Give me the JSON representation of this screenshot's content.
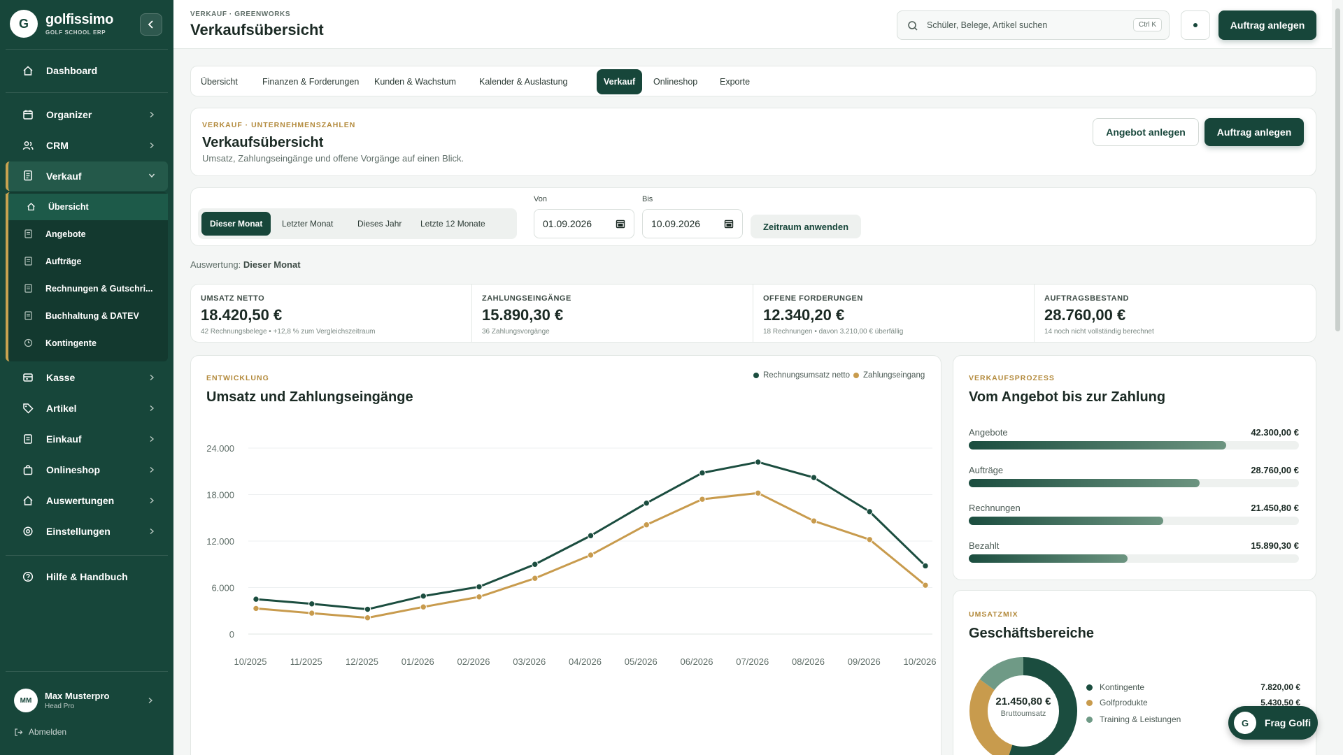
{
  "sidebar": {
    "brand": {
      "logo": "G",
      "name": "golfissimo",
      "sub": "GOLF SCHOOL ERP"
    },
    "collapse_icon": "chevron-left-icon",
    "items": [
      {
        "label": "Dashboard",
        "icon": "home-icon"
      },
      {
        "label": "Organizer",
        "icon": "calendar-icon"
      },
      {
        "label": "CRM",
        "icon": "users-icon"
      },
      {
        "label": "Verkauf",
        "icon": "document-icon"
      },
      {
        "label": "Kasse",
        "icon": "register-icon"
      },
      {
        "label": "Artikel",
        "icon": "tag-icon"
      },
      {
        "label": "Einkauf",
        "icon": "cart-icon"
      },
      {
        "label": "Onlineshop",
        "icon": "bag-icon"
      },
      {
        "label": "Auswertungen",
        "icon": "chart-icon"
      },
      {
        "label": "Einstellungen",
        "icon": "gear-icon"
      },
      {
        "label": "Hilfe & Handbuch",
        "icon": "help-icon"
      }
    ],
    "sub_items": [
      {
        "label": "Übersicht"
      },
      {
        "label": "Angebote"
      },
      {
        "label": "Aufträge"
      },
      {
        "label": "Rechnungen & Gutschri..."
      },
      {
        "label": "Buchhaltung & DATEV"
      },
      {
        "label": "Kontingente"
      }
    ],
    "user": {
      "initials": "MM",
      "name": "Max Musterpro",
      "role": "Head Pro"
    },
    "logout": "Abmelden"
  },
  "header": {
    "breadcrumb": "VERKAUF · GREENWORKS",
    "title": "Verkaufsübersicht",
    "search_placeholder": "Schüler, Belege, Artikel suchen",
    "shortcut": "Ctrl K",
    "primary_button": "Auftrag anlegen"
  },
  "tabs": [
    "Übersicht",
    "Finanzen & Forderungen",
    "Kunden & Wachstum",
    "Kalender & Auslastung",
    "Verkauf",
    "Onlineshop",
    "Exporte"
  ],
  "intro": {
    "eyebrow": "VERKAUF · UNTERNEHMENSZAHLEN",
    "title": "Verkaufsübersicht",
    "subtitle": "Umsatz, Zahlungseingänge und offene Vorgänge auf einen Blick.",
    "secondary_button": "Angebot anlegen",
    "primary_button": "Auftrag anlegen"
  },
  "filter": {
    "periods": [
      "Dieser Monat",
      "Letzter Monat",
      "Dieses Jahr",
      "Letzte 12 Monate"
    ],
    "from_label": "Von",
    "from_value": "01.09.2026",
    "to_label": "Bis",
    "to_value": "10.09.2026",
    "apply": "Zeitraum anwenden",
    "evaluation_label": "Auswertung:",
    "evaluation_value": "Dieser Monat"
  },
  "kpis": [
    {
      "label": "UMSATZ NETTO",
      "value": "18.420,50 €",
      "sub": "42 Rechnungsbelege • +12,8 % zum Vergleichszeitraum"
    },
    {
      "label": "ZAHLUNGSEINGÄNGE",
      "value": "15.890,30 €",
      "sub": "36 Zahlungsvorgänge"
    },
    {
      "label": "OFFENE FORDERUNGEN",
      "value": "12.340,20 €",
      "sub": "18 Rechnungen • davon 3.210,00 € überfällig"
    },
    {
      "label": "AUFTRAGSBESTAND",
      "value": "28.760,00 €",
      "sub": "14 noch nicht vollständig berechnet"
    }
  ],
  "trend": {
    "eyebrow": "ENTWICKLUNG",
    "title": "Umsatz und Zahlungseingänge"
  },
  "chart_data": {
    "type": "line",
    "title": "Umsatz und Zahlungseingänge",
    "x": [
      "10/2025",
      "11/2025",
      "12/2025",
      "01/2026",
      "02/2026",
      "03/2026",
      "04/2026",
      "05/2026",
      "06/2026",
      "07/2026",
      "08/2026",
      "09/2026",
      "10/2026"
    ],
    "y_ticks": [
      "0",
      "6.000",
      "12.000",
      "18.000",
      "24.000"
    ],
    "ylim": [
      0,
      24000
    ],
    "grid": true,
    "legend_position": "top-right",
    "series": [
      {
        "name": "Rechnungsumsatz netto",
        "color": "#1b4d3f",
        "values": [
          4500,
          3900,
          3200,
          4900,
          6100,
          9000,
          12700,
          16900,
          20800,
          22200,
          20200,
          15800,
          8800
        ]
      },
      {
        "name": "Zahlungseingang",
        "color": "#c89b4d",
        "values": [
          3300,
          2700,
          2100,
          3500,
          4800,
          7200,
          10200,
          14100,
          17400,
          18200,
          14600,
          12200,
          6300
        ]
      }
    ]
  },
  "funnel": {
    "eyebrow": "VERKAUFSPROZESS",
    "title": "Vom Angebot bis zur Zahlung",
    "rows": [
      {
        "label": "Angebote",
        "value": "42.300,00 €",
        "fraction": 0.78
      },
      {
        "label": "Aufträge",
        "value": "28.760,00 €",
        "fraction": 0.7
      },
      {
        "label": "Rechnungen",
        "value": "21.450,80 €",
        "fraction": 0.59
      },
      {
        "label": "Bezahlt",
        "value": "15.890,30 €",
        "fraction": 0.48
      }
    ]
  },
  "mix": {
    "eyebrow": "UMSATZMIX",
    "title": "Geschäftsbereiche",
    "center_value": "21.450,80 €",
    "center_label": "Bruttoumsatz",
    "rows": [
      {
        "label": "Kontingente",
        "value": "7.820,00 €",
        "color": "#1b4d3f",
        "share": 0.55
      },
      {
        "label": "Golfprodukte",
        "value": "5.430,50 €",
        "color": "#c89b4d",
        "share": 0.3
      },
      {
        "label": "Training & Leistungen",
        "value": "",
        "color": "#6f9a86",
        "share": 0.15
      }
    ]
  },
  "assistant": {
    "logo": "G",
    "label": "Frag Golfi"
  }
}
